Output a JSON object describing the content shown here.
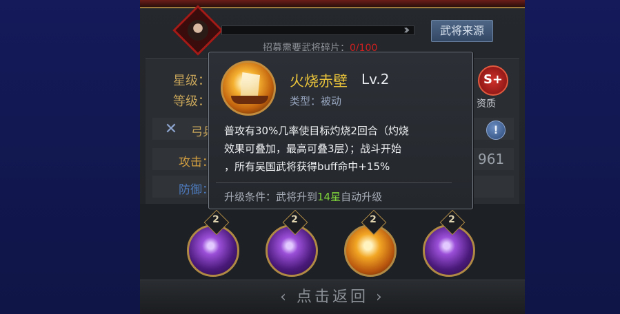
{
  "header": {
    "recruit_label": "招募需要武将碎片：",
    "recruit_count": "0/100",
    "source_button": "武将来源"
  },
  "info": {
    "star_label": "星级：",
    "grade_label": "等级：",
    "quality_badge": "S+",
    "quality_label": "资质",
    "troop_label": "弓兵",
    "attack_label": "攻击：",
    "defense_label": "防御：",
    "stat_value": "961",
    "info_icon": "!"
  },
  "tooltip": {
    "name": "火烧赤壁",
    "level": "Lv.2",
    "type_label": "类型：",
    "type_value": "被动",
    "description_line1": "普攻有30%几率使目标灼烧2回合（灼烧",
    "description_line2": "效果可叠加，最高可叠3层）；战斗开始",
    "description_line3": "，所有吴国武将获得buff命中+15%",
    "upgrade_prefix": "升级条件：武将升到",
    "upgrade_highlight": "14星",
    "upgrade_suffix": "自动升级"
  },
  "skills": [
    {
      "level": "2",
      "style": "purple"
    },
    {
      "level": "2",
      "style": "purple"
    },
    {
      "level": "2",
      "style": "fire"
    },
    {
      "level": "2",
      "style": "purple"
    }
  ],
  "footer": {
    "return_label": "点击返回",
    "left_arrow": "‹",
    "right_arrow": "›"
  },
  "colors": {
    "background": "#13164d",
    "panel": "#25282c",
    "skill_name": "#e8c23a",
    "highlight_green": "#7ed43a",
    "recruit_count_red": "#d02020",
    "gold_border": "#b08a45"
  }
}
